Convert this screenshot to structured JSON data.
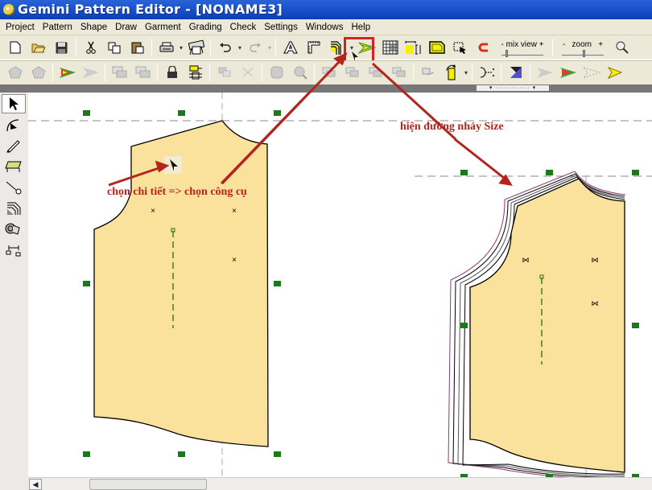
{
  "window": {
    "title": "Gemini Pattern Editor - [NONAME3]"
  },
  "menu": [
    "Project",
    "Pattern",
    "Shape",
    "Draw",
    "Garment",
    "Grading",
    "Check",
    "Settings",
    "Windows",
    "Help"
  ],
  "toolbar": {
    "mix_view_label": "- mix view +",
    "zoom_label": "-   zoom   +",
    "mix_view_level": 0.1,
    "zoom_level": 0.55
  },
  "annotations": {
    "select_then_tool": "chọn chi tiết => chọn công cụ",
    "show_size_lines": "hiện đường nhảy Size"
  },
  "colors": {
    "piece_fill": "#fbe29c",
    "handle": "#1a7a1a",
    "annotation": "#b2241c",
    "highlight": "#d42222",
    "graded_line": "#8a3a7a"
  }
}
